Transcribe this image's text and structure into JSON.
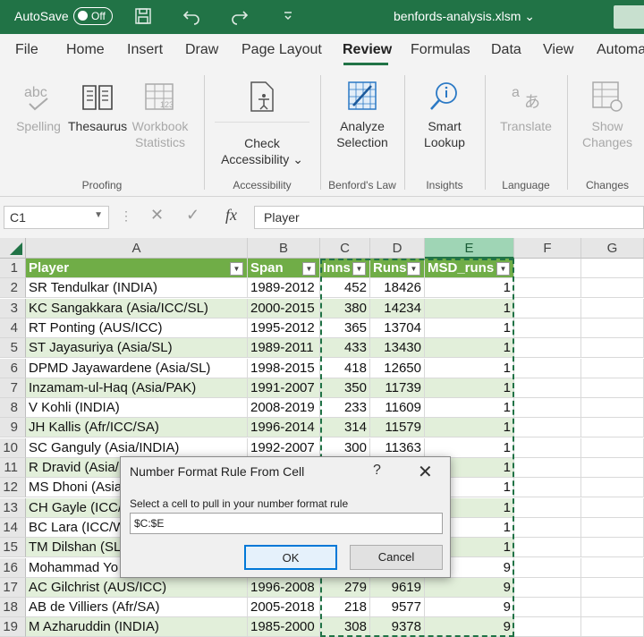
{
  "titlebar": {
    "autosave_label": "AutoSave",
    "autosave_state": "Off",
    "filename": "benfords-analysis.xlsm ⌄",
    "icons": [
      "save-icon",
      "undo-icon",
      "redo-icon",
      "customize-icon"
    ]
  },
  "tabs": [
    "File",
    "Home",
    "Insert",
    "Draw",
    "Page Layout",
    "Review",
    "Formulas",
    "Data",
    "View",
    "Automa"
  ],
  "active_tab": "Review",
  "ribbon": {
    "buttons": [
      {
        "label": "Spelling",
        "icon": "abc-check-icon",
        "disabled": true
      },
      {
        "label": "Thesaurus",
        "icon": "book-icon",
        "disabled": false
      },
      {
        "label": "Workbook Statistics",
        "icon": "workbook-statistics-icon",
        "disabled": true
      },
      {
        "label": "Check Accessibility ⌄",
        "icon": "accessibility-icon",
        "disabled": false
      },
      {
        "label": "Analyze Selection",
        "icon": "analyze-selection-icon",
        "disabled": false
      },
      {
        "label": "Smart Lookup",
        "icon": "smart-lookup-icon",
        "disabled": false
      },
      {
        "label": "Translate",
        "icon": "translate-icon",
        "disabled": true
      },
      {
        "label": "Show Changes",
        "icon": "show-changes-icon",
        "disabled": true
      }
    ],
    "groups": [
      "Proofing",
      "Accessibility",
      "Benford's Law",
      "Insights",
      "Language",
      "Changes"
    ]
  },
  "formula_bar": {
    "name_box": "C1",
    "formula": "Player"
  },
  "grid": {
    "columns": [
      "A",
      "B",
      "C",
      "D",
      "E",
      "F",
      "G"
    ],
    "selected_column": "E",
    "header": [
      "Player",
      "Span",
      "Inns",
      "Runs",
      "MSD_runs"
    ],
    "rows": [
      [
        "SR Tendulkar (INDIA)",
        "1989-2012",
        "452",
        "18426",
        "1"
      ],
      [
        "KC Sangakkara (Asia/ICC/SL)",
        "2000-2015",
        "380",
        "14234",
        "1"
      ],
      [
        "RT Ponting (AUS/ICC)",
        "1995-2012",
        "365",
        "13704",
        "1"
      ],
      [
        "ST Jayasuriya (Asia/SL)",
        "1989-2011",
        "433",
        "13430",
        "1"
      ],
      [
        "DPMD Jayawardene (Asia/SL)",
        "1998-2015",
        "418",
        "12650",
        "1"
      ],
      [
        "Inzamam-ul-Haq (Asia/PAK)",
        "1991-2007",
        "350",
        "11739",
        "1"
      ],
      [
        "V Kohli (INDIA)",
        "2008-2019",
        "233",
        "11609",
        "1"
      ],
      [
        "JH Kallis (Afr/ICC/SA)",
        "1996-2014",
        "314",
        "11579",
        "1"
      ],
      [
        "SC Ganguly (Asia/INDIA)",
        "1992-2007",
        "300",
        "11363",
        "1"
      ],
      [
        "R Dravid (Asia/",
        "",
        "",
        "",
        "1"
      ],
      [
        "MS Dhoni (Asia",
        "",
        "",
        "",
        "1"
      ],
      [
        "CH Gayle (ICC/",
        "",
        "",
        "",
        "1"
      ],
      [
        "BC Lara (ICC/W",
        "",
        "",
        "",
        "1"
      ],
      [
        "TM Dilshan (SL)",
        "",
        "",
        "",
        "1"
      ],
      [
        "Mohammad Yo",
        "",
        "",
        "",
        "9"
      ],
      [
        "AC Gilchrist (AUS/ICC)",
        "1996-2008",
        "279",
        "9619",
        "9"
      ],
      [
        "AB de Villiers (Afr/SA)",
        "2005-2018",
        "218",
        "9577",
        "9"
      ],
      [
        "M Azharuddin (INDIA)",
        "1985-2000",
        "308",
        "9378",
        "9"
      ]
    ]
  },
  "dialog": {
    "title": "Number Format Rule From Cell",
    "help": "?",
    "close": "✕",
    "prompt": "Select a cell to pull in your number format rule",
    "input_value": "$C:$E",
    "ok_label": "OK",
    "cancel_label": "Cancel"
  }
}
